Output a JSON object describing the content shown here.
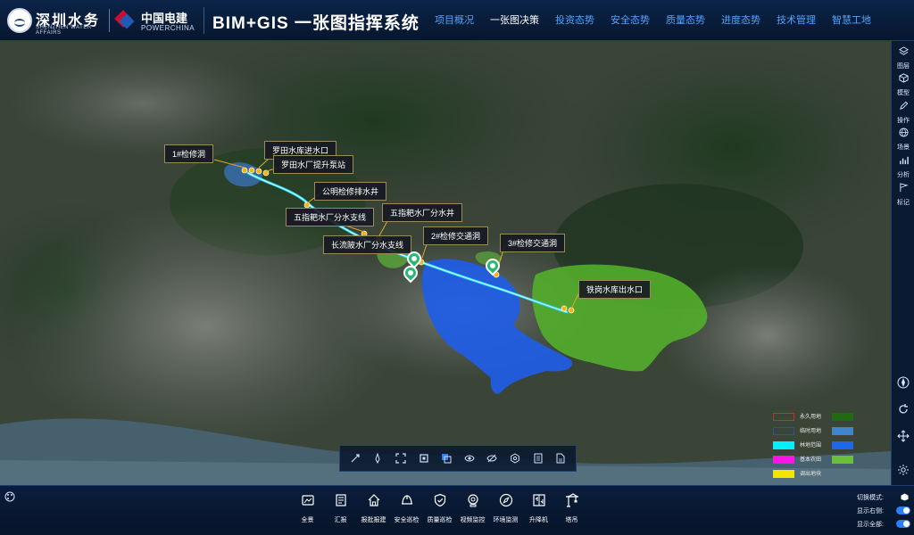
{
  "header": {
    "logo_primary_name": "深圳水务",
    "logo_primary_en": "SHENZHEN WATER AFFAIRS",
    "logo_secondary_name": "中国电建",
    "logo_secondary_en": "POWERCHINA",
    "system_title": "BIM+GIS 一张图指挥系统",
    "nav": [
      {
        "label": "项目概况",
        "active": false
      },
      {
        "label": "一张图决策",
        "active": true
      },
      {
        "label": "投资态势",
        "active": false
      },
      {
        "label": "安全态势",
        "active": false
      },
      {
        "label": "质量态势",
        "active": false
      },
      {
        "label": "进度态势",
        "active": false
      },
      {
        "label": "技术管理",
        "active": false
      },
      {
        "label": "智慧工地",
        "active": false
      }
    ]
  },
  "map": {
    "labels": [
      "1#检修洞",
      "罗田水库进水口",
      "罗田水厂提升泵站",
      "公明检修排水井",
      "五指耙水厂分水支线",
      "五指耙水厂分水井",
      "长流陂水厂分水支线",
      "2#检修交通洞",
      "3#检修交通洞",
      "铁岗水库出水口"
    ],
    "legend": [
      {
        "label": "永久用地",
        "color": "#d8262a",
        "style": "outline"
      },
      {
        "label": "临时用地",
        "color": "#1e3a8a",
        "style": "outline"
      },
      {
        "label": "林地范围",
        "color": "#00f0ff",
        "style": "fill"
      },
      {
        "label": "基本农田",
        "color": "#ff14e8",
        "style": "fill"
      },
      {
        "label": "调出地块",
        "color": "#f2e500",
        "style": "fill"
      },
      {
        "label": "",
        "color": "#1f6a12",
        "style": "fill"
      },
      {
        "label": "",
        "color": "#3f86cc",
        "style": "fill"
      },
      {
        "label": "",
        "color": "#1e68e8",
        "style": "fill"
      },
      {
        "label": "",
        "color": "#6cbf3a",
        "style": "fill"
      }
    ],
    "tools": [
      "measure-icon",
      "compass-icon",
      "frame-icon",
      "capture-icon",
      "layer-icon",
      "eye-icon",
      "eye-off-icon",
      "settings-icon",
      "document-icon",
      "report-icon"
    ]
  },
  "right_panel": {
    "items": [
      {
        "label": "图层",
        "icon": "layers-icon"
      },
      {
        "label": "模型",
        "icon": "cube-icon"
      },
      {
        "label": "操作",
        "icon": "edit-icon"
      },
      {
        "label": "场景",
        "icon": "globe-icon"
      },
      {
        "label": "分析",
        "icon": "chart-icon"
      },
      {
        "label": "标记",
        "icon": "flag-icon"
      }
    ],
    "controls": [
      "compass-icon",
      "refresh-icon",
      "move-icon",
      "settings-icon"
    ]
  },
  "bottom_toolbar": {
    "tools": [
      {
        "label": "全景",
        "icon": "panorama-icon"
      },
      {
        "label": "汇报",
        "icon": "report-icon"
      },
      {
        "label": "报批报建",
        "icon": "house-icon"
      },
      {
        "label": "安全巡检",
        "icon": "helmet-icon"
      },
      {
        "label": "质量巡检",
        "icon": "shield-check-icon"
      },
      {
        "label": "视频监控",
        "icon": "camera-icon"
      },
      {
        "label": "环境监测",
        "icon": "compass-icon"
      },
      {
        "label": "升降机",
        "icon": "elevator-icon"
      },
      {
        "label": "塔吊",
        "icon": "crane-icon"
      }
    ],
    "toggles": {
      "switch_mode_label": "切换模式:",
      "show_right_label": "显示右侧:",
      "show_all_label": "显示全部:",
      "show_right_on": true,
      "show_all_on": true
    }
  }
}
